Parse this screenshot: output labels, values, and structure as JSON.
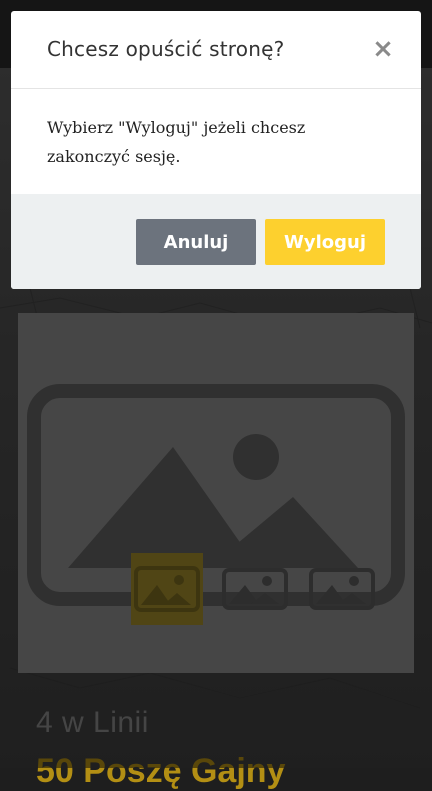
{
  "modal": {
    "title": "Chcesz opuścić stronę?",
    "close_symbol": "×",
    "message": "Wybierz \"Wyloguj\" jeżeli chcesz zakonczyć sesję.",
    "cancel_label": "Anuluj",
    "logout_label": "Wyloguj"
  },
  "game": {
    "category": "4 w Linii",
    "title": "50 Poszę Gajny"
  },
  "icons": {
    "close": "close-icon",
    "image_placeholder": "image-placeholder-icon"
  },
  "colors": {
    "logout_button": "#fdd02e",
    "cancel_button": "#6c737d",
    "footer_bg": "#edf0f1",
    "accent": "#b38f14"
  }
}
